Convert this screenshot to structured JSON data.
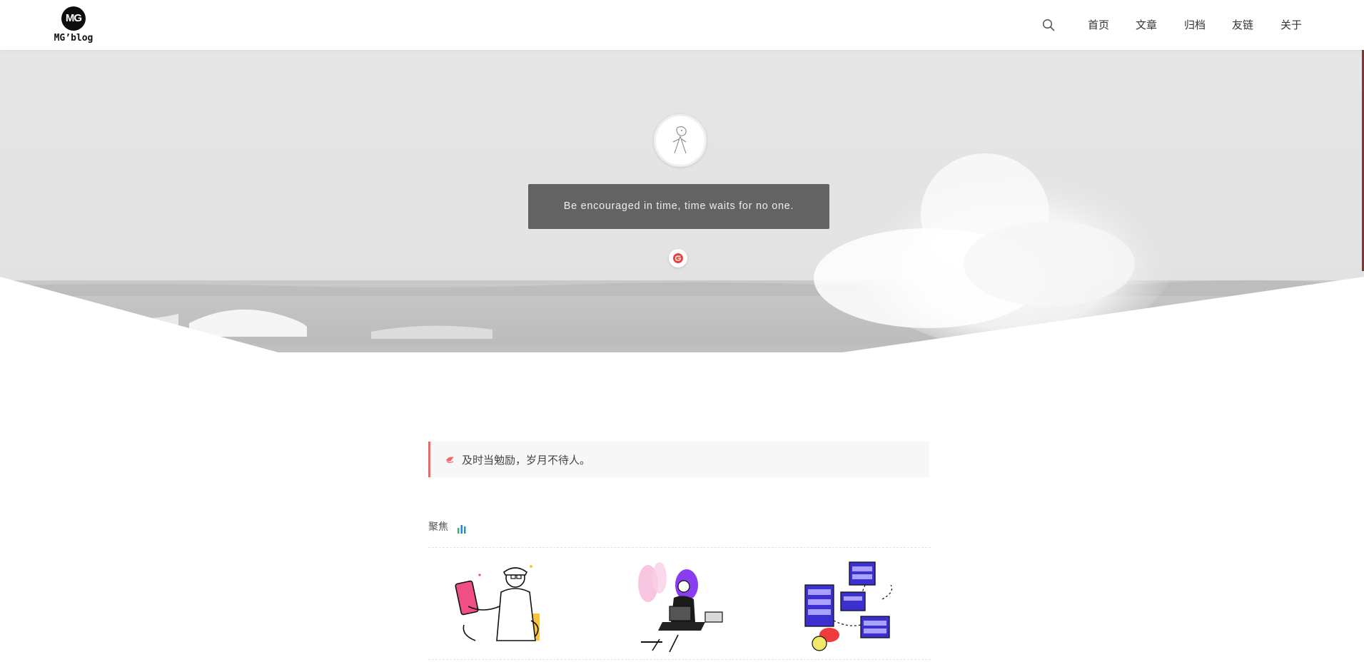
{
  "brand": {
    "logo_text": "MG",
    "name": "MG’blog"
  },
  "nav": {
    "search_icon": "search-icon",
    "items": [
      {
        "label": "首页"
      },
      {
        "label": "文章"
      },
      {
        "label": "归档"
      },
      {
        "label": "友链"
      },
      {
        "label": "关于"
      }
    ]
  },
  "hero": {
    "motto": "Be encouraged in time, time waits for no one.",
    "avatar_icon": "avatar-sketch-icon",
    "social_icon": "gitee-icon"
  },
  "notice": {
    "icon": "horn-icon",
    "text": "及时当勉励，岁月不待人。"
  },
  "focus": {
    "title": "聚焦",
    "icon": "bar-chart-icon",
    "cards": [
      {
        "icon": "person-reading-illustration"
      },
      {
        "icon": "woman-laptop-illustration"
      },
      {
        "icon": "servers-illustration"
      }
    ]
  },
  "colors": {
    "accent_red": "#ef6767",
    "motto_bg": "#585858"
  }
}
